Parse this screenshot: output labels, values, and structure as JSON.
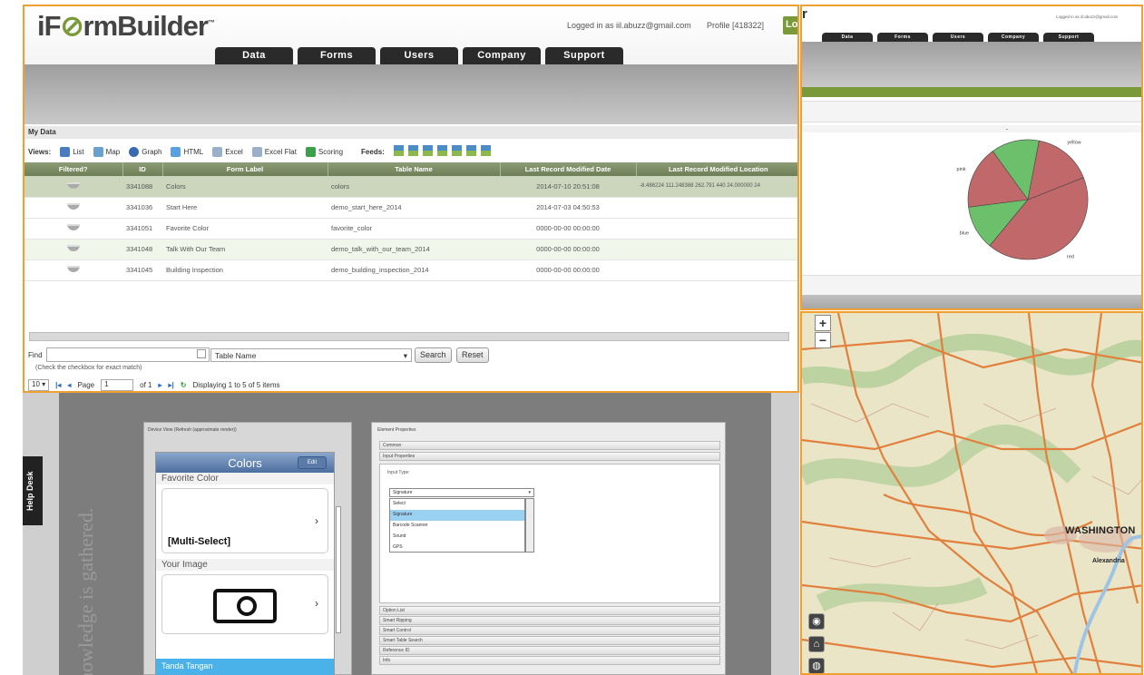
{
  "app": {
    "logo_text": "iFormBuilder",
    "logo_tm": "™",
    "logged_in": "Logged in as iil.abuzz@gmail.com",
    "profile": "Profile [418322]",
    "logout_short": "Lo",
    "tabs": [
      "Data",
      "Forms",
      "Users",
      "Company",
      "Support"
    ]
  },
  "my_data": {
    "heading": "My Data",
    "views_label": "Views:",
    "views": [
      "List",
      "Map",
      "Graph",
      "HTML",
      "Excel",
      "Excel Flat",
      "Scoring"
    ],
    "feeds_label": "Feeds:",
    "columns": [
      "Filtered?",
      "ID",
      "Form Label",
      "Table Name",
      "Last Record Modified Date",
      "Last Record Modified Location"
    ],
    "rows": [
      {
        "id": "3341088",
        "label": "Colors",
        "table": "colors",
        "date": "2014-07-10 20:51:08",
        "location": "-8.486224 111.248388 262.791 440 24.000000 24"
      },
      {
        "id": "3341036",
        "label": "Start Here",
        "table": "demo_start_here_2014",
        "date": "2014-07-03 04:50:53",
        "location": ""
      },
      {
        "id": "3341051",
        "label": "Favorite Color",
        "table": "favorite_color",
        "date": "0000-00-00 00:00:00",
        "location": ""
      },
      {
        "id": "3341048",
        "label": "Talk With Our Team",
        "table": "demo_talk_with_our_team_2014",
        "date": "0000-00-00 00:00:00",
        "location": ""
      },
      {
        "id": "3341045",
        "label": "Building Inspection",
        "table": "demo_building_inspection_2014",
        "date": "0000-00-00 00:00:00",
        "location": ""
      }
    ],
    "find_label": "Find",
    "find_value": "",
    "search_field": "Table Name",
    "search_btn": "Search",
    "reset_btn": "Reset",
    "exact_hint": "(Check the checkbox for exact match)",
    "page_size": "10",
    "page_label": "Page",
    "page_value": "1",
    "of_label": "of 1",
    "display_text": "Displaying 1 to 5 of 5 items"
  },
  "chart_panel": {
    "logo_text": "r",
    "logged": "Logged in as iil.abuzz@gmail.com",
    "tabs": [
      "Data",
      "Forms",
      "Users",
      "Company",
      "Support"
    ]
  },
  "chart_data": {
    "type": "pie",
    "categories": [
      "red",
      "blue",
      "pink",
      "green",
      "yellow"
    ],
    "values": [
      42,
      12,
      17,
      13,
      16
    ],
    "colors": [
      "#c0686a",
      "#6cc06c",
      "#c0686a",
      "#6cc06c",
      "#c0686a"
    ]
  },
  "editor": {
    "side_text": "knowledge is gathered.",
    "help_tab": "Help Desk",
    "device_caption": "Device View (Refresh (approximate render))",
    "screen_title": "Colors",
    "edit_btn": "Edit",
    "fav_label": "Favorite Color",
    "multi_select": "[Multi-Select]",
    "image_label": "Your Image",
    "bottom_item": "Tanda Tangan",
    "properties_title": "Element Properties",
    "sections_top": [
      "Common",
      "Input Properties"
    ],
    "input_type_label": "Input Type:",
    "input_type_value": "Signature",
    "options": [
      "Select",
      "Signature",
      "Barcode Scanner",
      "Sound",
      "GPS"
    ],
    "sections_bottom": [
      "Option List",
      "Smart Ripping",
      "Smart Control",
      "Smart Table Search",
      "Reference ID",
      "Info"
    ]
  },
  "map": {
    "zoom_in": "+",
    "zoom_out": "−",
    "city": "WASHINGTON",
    "city2": "Alexandria"
  }
}
